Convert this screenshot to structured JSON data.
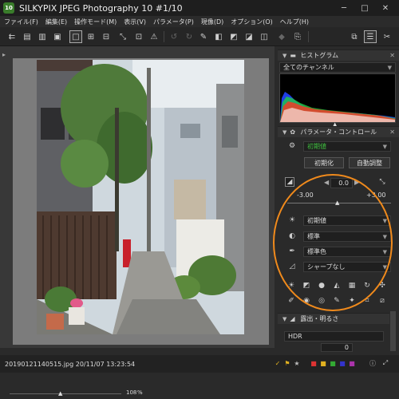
{
  "window": {
    "title": "SILKYPIX JPEG Photography 10   #1/10",
    "app_badge": "10"
  },
  "menu": [
    "ファイル(F)",
    "編集(E)",
    "操作モード(M)",
    "表示(V)",
    "パラメータ(P)",
    "現像(D)",
    "オプション(O)",
    "ヘルプ(H)"
  ],
  "viewer": {
    "zoom_value": "108",
    "zoom_unit": "%"
  },
  "status": {
    "file_info": "20190121140515.jpg 20/11/07 13:23:54"
  },
  "histogram": {
    "title": "ヒストグラム",
    "channel": "全てのチャンネル"
  },
  "param_control": {
    "title": "パラメータ・コントロール",
    "preset": "初期値",
    "reset_label": "初期化",
    "auto_label": "自動調整",
    "exposure_value": "0.0",
    "range_min": "-3.00",
    "range_max": "+3.00",
    "rows": [
      {
        "value": "初期値"
      },
      {
        "value": "標準"
      },
      {
        "value": "標準色"
      },
      {
        "value": "シャープなし"
      }
    ]
  },
  "exposure_panel": {
    "title": "露出・明るさ",
    "mode": "HDR",
    "value": "0"
  },
  "colors": {
    "accent_orange": "#f08a1c",
    "preset_green": "#3fbf3f"
  }
}
